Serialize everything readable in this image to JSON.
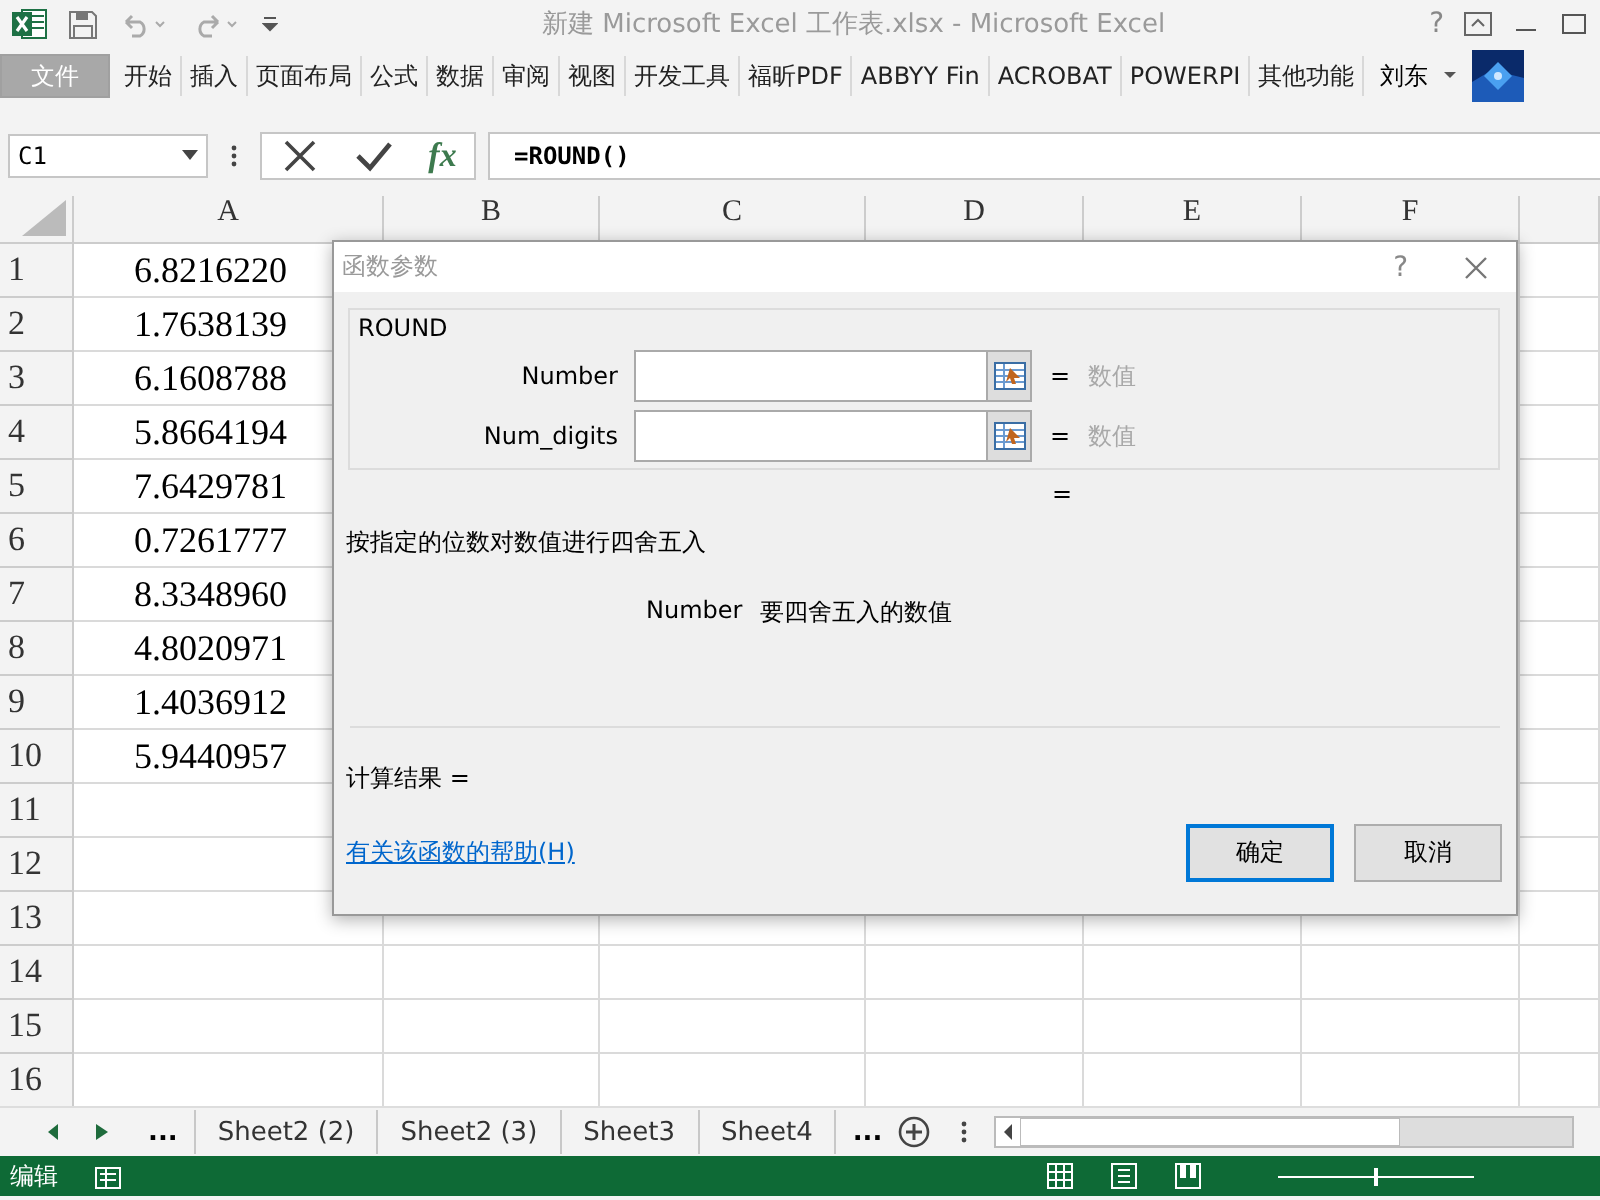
{
  "window": {
    "title": "新建 Microsoft Excel 工作表.xlsx - Microsoft Excel",
    "help": "?"
  },
  "ribbon": {
    "file_tab": "文件",
    "tabs": [
      {
        "label": "开始",
        "selected": false
      },
      {
        "label": "插入",
        "selected": false
      },
      {
        "label": "页面布局",
        "selected": false
      },
      {
        "label": "公式",
        "selected": false
      },
      {
        "label": "数据",
        "selected": false
      },
      {
        "label": "审阅",
        "selected": false
      },
      {
        "label": "视图",
        "selected": false
      },
      {
        "label": "开发工具",
        "selected": false
      },
      {
        "label": "福昕PDF",
        "selected": false
      },
      {
        "label": "ABBYY Fin",
        "selected": false
      },
      {
        "label": "ACROBAT",
        "selected": false
      },
      {
        "label": "POWERPI",
        "selected": false
      },
      {
        "label": "其他功能",
        "selected": false
      }
    ],
    "user": "刘东"
  },
  "formula_bar": {
    "name_box": "C1",
    "formula": "=ROUND()",
    "fx": "fx"
  },
  "sheet": {
    "columns": [
      "A",
      "B",
      "C",
      "D",
      "E",
      "F"
    ],
    "rows": [
      {
        "number": "1",
        "a": "6.8216220"
      },
      {
        "number": "2",
        "a": "1.7638139"
      },
      {
        "number": "3",
        "a": "6.1608788"
      },
      {
        "number": "4",
        "a": "5.8664194"
      },
      {
        "number": "5",
        "a": "7.6429781"
      },
      {
        "number": "6",
        "a": "0.7261777"
      },
      {
        "number": "7",
        "a": "8.3348960"
      },
      {
        "number": "8",
        "a": "4.8020971"
      },
      {
        "number": "9",
        "a": "1.4036912"
      },
      {
        "number": "10",
        "a": "5.9440957"
      },
      {
        "number": "11",
        "a": ""
      },
      {
        "number": "12",
        "a": ""
      },
      {
        "number": "13",
        "a": ""
      },
      {
        "number": "14",
        "a": ""
      },
      {
        "number": "15",
        "a": ""
      },
      {
        "number": "16",
        "a": ""
      }
    ]
  },
  "dialog": {
    "title": "函数参数",
    "help": "?",
    "function_name": "ROUND",
    "arguments": [
      {
        "label": "Number",
        "equals": "=",
        "value_hint": "数值"
      },
      {
        "label": "Num_digits",
        "equals": "=",
        "value_hint": "数值"
      }
    ],
    "result_equals": "=",
    "description": "按指定的位数对数值进行四舍五入",
    "arg_name": "Number",
    "arg_help": "要四舍五入的数值",
    "calc_result": "计算结果 =",
    "help_link": "有关该函数的帮助(H)",
    "buttons": [
      {
        "label": "确定",
        "selected": true
      },
      {
        "label": "取消",
        "selected": false
      }
    ]
  },
  "sheet_tabs": {
    "more_left": "...",
    "tabs": [
      {
        "label": "Sheet2 (2)",
        "selected": false
      },
      {
        "label": "Sheet2 (3)",
        "selected": false
      },
      {
        "label": "Sheet3",
        "selected": false
      },
      {
        "label": "Sheet4",
        "selected": false
      }
    ],
    "more_right": "..."
  },
  "status_bar": {
    "mode": "编辑",
    "zoom": {
      "level": 0.5
    }
  }
}
